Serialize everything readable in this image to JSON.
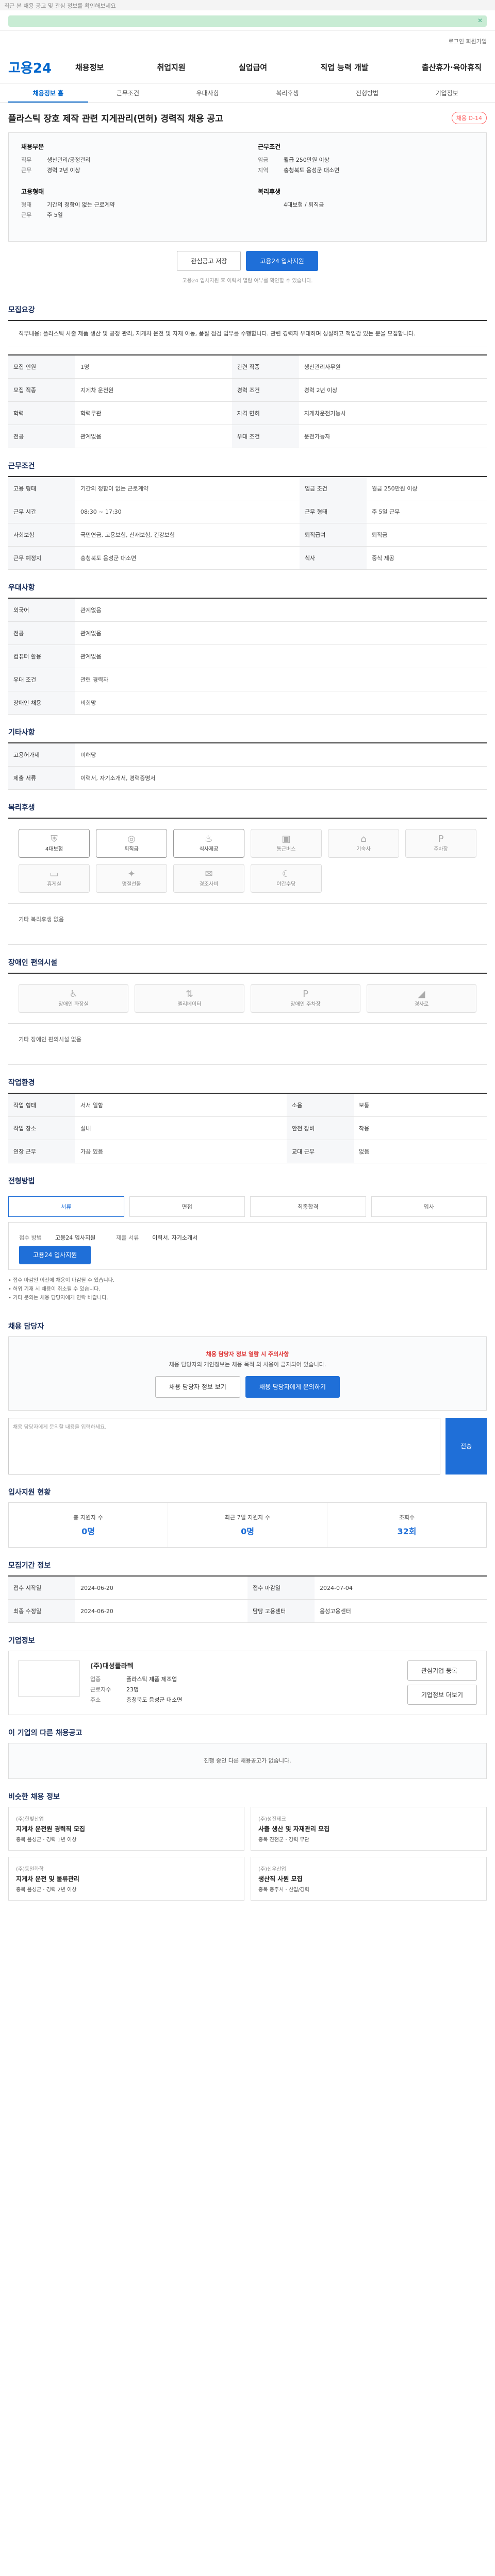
{
  "top_notice": "최근 본 채용 공고 및 관심 정보를 확인해보세요",
  "header": {
    "logo": "고용24",
    "gnb": [
      "채용정보",
      "취업지원",
      "실업급여",
      "직업 능력 개발",
      "출산휴가·육아휴직"
    ],
    "util": "로그인  회원가입"
  },
  "tabs": [
    "채용정보 홈",
    "근무조건",
    "우대사항",
    "복리후생",
    "전형방법",
    "기업정보"
  ],
  "title": "플라스틱 장호 제작 관련 지게관리(면허) 경력직 채용 공고",
  "badge": "채용 D-14",
  "summary": {
    "left": [
      {
        "h": "채용부문",
        "rows": [
          [
            "직무",
            "생산관리/공정관리"
          ],
          [
            "근무",
            "경력 2년 이상"
          ]
        ]
      },
      {
        "h": "고용형태",
        "rows": [
          [
            "형태",
            "기간의 정함이 없는 근로계약"
          ],
          [
            "근무",
            "주 5일"
          ]
        ]
      }
    ],
    "right": [
      {
        "h": "근무조건",
        "rows": [
          [
            "임금",
            "월급 250만원 이상"
          ],
          [
            "지역",
            "충청북도 음성군 대소면"
          ]
        ]
      },
      {
        "h": "복리후생",
        "rows": [
          [
            "",
            "4대보험 / 퇴직금"
          ]
        ]
      }
    ]
  },
  "actions": {
    "save": "관심공고 저장",
    "apply": "고용24 입사지원"
  },
  "apply_note": "고용24 입사지원 후 이력서 열람 여부를 확인할 수 있습니다.",
  "sections": {
    "recruit": "모집요강",
    "conditions": "근무조건",
    "prefer": "우대사항",
    "other": "기타사항",
    "welfare": "복리후생",
    "disabled": "장애인 편의시설",
    "env": "작업환경",
    "process": "전형방법",
    "qa": "채용 담당자",
    "stats": "입사지원 현황",
    "period": "모집기간 정보",
    "company": "기업정보",
    "related": "이 기업의 다른 채용공고",
    "similar": "비슷한 채용 정보"
  },
  "recruit_desc": "직무내용: 플라스틱 사출 제품 생산 및 공정 관리, 지게차 운전 및 자재 이동, 품질 점검 업무를 수행합니다. 관련 경력자 우대하며 성실하고 책임감 있는 분을 모집합니다.",
  "recruit_table": [
    [
      "모집 인원",
      "1명",
      "관련 직종",
      "생산관리사무원"
    ],
    [
      "모집 직종",
      "지게차 운전원",
      "경력 조건",
      "경력 2년 이상"
    ],
    [
      "학력",
      "학력무관",
      "자격 면허",
      "지게차운전기능사"
    ],
    [
      "전공",
      "관계없음",
      "우대 조건",
      "운전가능자"
    ]
  ],
  "conditions_table": [
    [
      "고용 형태",
      "기간의 정함이 없는 근로계약",
      "임금 조건",
      "월급 250만원 이상"
    ],
    [
      "근무 시간",
      "08:30 ~ 17:30",
      "근무 형태",
      "주 5일 근무"
    ],
    [
      "사회보험",
      "국민연금, 고용보험, 산재보험, 건강보험",
      "퇴직급여",
      "퇴직금"
    ],
    [
      "근무 예정지",
      "충청북도 음성군 대소면",
      "식사",
      "중식 제공"
    ]
  ],
  "prefer_table": [
    [
      "외국어",
      "관계없음"
    ],
    [
      "전공",
      "관계없음"
    ],
    [
      "컴퓨터 활용",
      "관계없음"
    ],
    [
      "우대 조건",
      "관련 경력자"
    ],
    [
      "장애인 채용",
      "비희망"
    ]
  ],
  "other_table": [
    [
      "고용허가제",
      "미해당"
    ],
    [
      "제출 서류",
      "이력서, 자기소개서, 경력증명서"
    ]
  ],
  "welfare_icons": [
    "4대보험",
    "퇴직금",
    "식사제공",
    "통근버스",
    "기숙사",
    "주차장",
    "휴게실",
    "명절선물",
    "경조사비",
    "야간수당"
  ],
  "welfare_note": "기타 복리후생 없음",
  "disabled_icons": [
    "장애인 화장실",
    "엘리베이터",
    "장애인 주차장",
    "경사로"
  ],
  "disabled_note": "기타 장애인 편의시설 없음",
  "env_table": [
    [
      "작업 형태",
      "서서 일함",
      "소음",
      "보통"
    ],
    [
      "작업 장소",
      "실내",
      "안전 장비",
      "착용"
    ],
    [
      "연장 근무",
      "가끔 있음",
      "교대 근무",
      "없음"
    ]
  ],
  "process_steps": [
    "서류",
    "면접",
    "최종합격",
    "입사"
  ],
  "apply_method": {
    "method_label": "접수 방법",
    "method": "고용24 입사지원",
    "doc_label": "제출 서류",
    "doc": "이력서, 자기소개서"
  },
  "apply_btn": "고용24 입사지원",
  "bullets": [
    "접수 마감일 이전에 채용이 마감될 수 있습니다.",
    "허위 기재 시 채용이 취소될 수 있습니다.",
    "기타 문의는 채용 담당자에게 연락 바랍니다."
  ],
  "qa": {
    "warn": "채용 담당자 정보 열람 시 주의사항",
    "desc": "채용 담당자의 개인정보는 채용 목적 외 사용이 금지되어 있습니다.",
    "btn1": "채용 담당자 정보 보기",
    "btn2": "채용 담당자에게 문의하기",
    "placeholder": "채용 담당자에게 문의할 내용을 입력하세요.",
    "send": "전송"
  },
  "stats": [
    {
      "label": "총 지원자 수",
      "value": "0명"
    },
    {
      "label": "최근 7일 지원자 수",
      "value": "0명"
    },
    {
      "label": "조회수",
      "value": "32회"
    }
  ],
  "period_table": [
    [
      "접수 시작일",
      "2024-06-20",
      "접수 마감일",
      "2024-07-04"
    ],
    [
      "최종 수정일",
      "2024-06-20",
      "담당 고용센터",
      "음성고용센터"
    ]
  ],
  "company": {
    "name": "(주)대성플라텍",
    "rows": [
      [
        "업종",
        "플라스틱 제품 제조업"
      ],
      [
        "근로자수",
        "23명"
      ],
      [
        "주소",
        "충청북도 음성군 대소면"
      ]
    ],
    "follow": "관심기업 등록",
    "more": "기업정보 더보기"
  },
  "related_empty": "진행 중인 다른 채용공고가 없습니다.",
  "similar_cards": [
    {
      "co": "(주)한빛산업",
      "t": "지게차 운전원 경력직 모집",
      "tag": "충북 음성군 · 경력 1년 이상"
    },
    {
      "co": "(주)성진테크",
      "t": "사출 생산 및 자재관리 모집",
      "tag": "충북 진천군 · 경력 무관"
    },
    {
      "co": "(주)동일화학",
      "t": "지게차 운전 및 물류관리",
      "tag": "충북 음성군 · 경력 2년 이상"
    },
    {
      "co": "(주)신우산업",
      "t": "생산직 사원 모집",
      "tag": "충북 충주시 · 신입/경력"
    }
  ]
}
